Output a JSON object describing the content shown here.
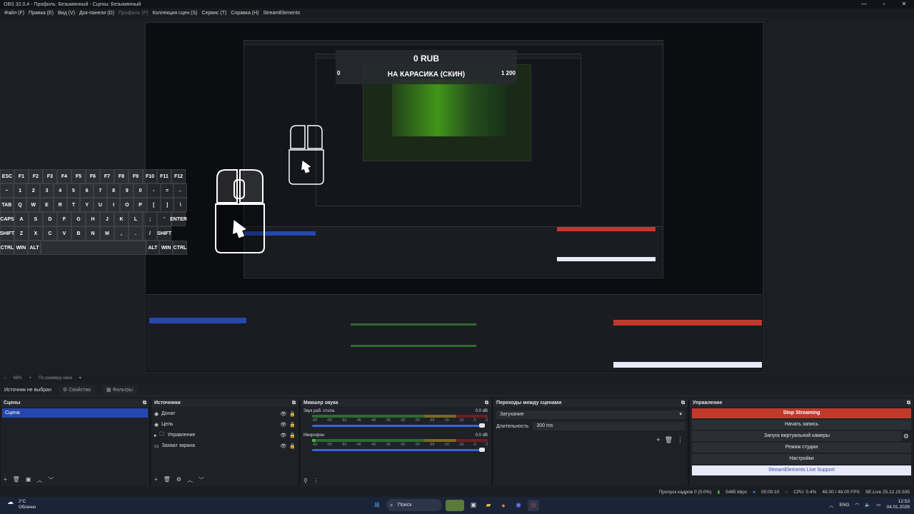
{
  "window": {
    "title": "OBS 32.0.4 - Профиль: Безымянный - Сцены: Безымянный"
  },
  "menu": {
    "items": [
      "Файл (F)",
      "Правка (E)",
      "Вид (V)",
      "Док-панели (D)",
      "Профиль (P)",
      "Коллекция сцен (S)",
      "Сервис (T)",
      "Справка (H)",
      "StreamElements"
    ]
  },
  "overlay": {
    "amount": "0 RUB",
    "title": "НА КАРАСИКА (СКИН)",
    "goal_left": "0",
    "goal_right": "1 200"
  },
  "keyboard": {
    "rows": [
      [
        "ESC",
        "F1",
        "F2",
        "F3",
        "F4",
        "F5",
        "F6",
        "F7",
        "F8",
        "F9",
        "F10",
        "F11",
        "F12"
      ],
      [
        "~",
        "1",
        "2",
        "3",
        "4",
        "5",
        "6",
        "7",
        "8",
        "9",
        "0",
        "-",
        "=",
        "←"
      ],
      [
        "TAB",
        "Q",
        "W",
        "E",
        "R",
        "T",
        "Y",
        "U",
        "I",
        "O",
        "P",
        "[",
        "]",
        "\\"
      ],
      [
        "CAPS",
        "A",
        "S",
        "D",
        "F",
        "G",
        "H",
        "J",
        "K",
        "L",
        ";",
        "'",
        "ENTER"
      ],
      [
        "SHIFT",
        "Z",
        "X",
        "C",
        "V",
        "B",
        "N",
        "M",
        ",",
        ".",
        "/",
        "SHIFT"
      ],
      [
        "CTRL",
        "WIN",
        "ALT",
        "",
        "ALT",
        "WIN",
        "CTRL"
      ]
    ]
  },
  "zoombar": {
    "zoom": "68%",
    "mode": "По размеру окна"
  },
  "source_bar": {
    "label": "Источник не выбран",
    "props": "Свойства",
    "filters": "Фильтры"
  },
  "scenes": {
    "title": "Сцены",
    "items": [
      "Сцена"
    ]
  },
  "sources": {
    "title": "Источники",
    "items": [
      "Донат",
      "Цель",
      "Управление",
      "Захват экрана"
    ]
  },
  "mixer": {
    "title": "Микшер звука",
    "channels": [
      {
        "name": "Звук раб. стола",
        "db": "0.0 dB",
        "level": 0
      },
      {
        "name": "Микрофон",
        "db": "0.0 dB",
        "level": 0.02
      }
    ],
    "scale": [
      "-60",
      "-55",
      "-50",
      "-45",
      "-40",
      "-35",
      "-30",
      "-25",
      "-20",
      "-15",
      "-10",
      "-5",
      "0"
    ]
  },
  "transitions": {
    "title": "Переходы между сценами",
    "selected": "Затухание",
    "duration_label": "Длительность",
    "duration": "300 ms"
  },
  "controls": {
    "title": "Управление",
    "stop": "Stop Streaming",
    "record": "Начать запись",
    "virtualcam": "Запуск виртуальной камеры",
    "studio": "Режим студии",
    "settings": "Настройки",
    "live_support": "StreamElements Live Support"
  },
  "status": {
    "dropped": "Пропуск кадров 0 (0.0%)",
    "bitrate": "5485 kbps",
    "time": "00:00:10",
    "cpu": "CPU: 0.4%",
    "fps": "48.00 / 48.00 FPS",
    "version": "SE.Live 25.12.15.535"
  },
  "taskbar": {
    "weather_temp": "2°C",
    "weather_desc": "Облачно",
    "search": "Поиск",
    "lang": "ENG",
    "time": "12:53",
    "date": "04.01.2026"
  },
  "colors": {
    "accent": "#2547b0",
    "stop": "#c0392b",
    "taskbar": "#1a2436"
  }
}
